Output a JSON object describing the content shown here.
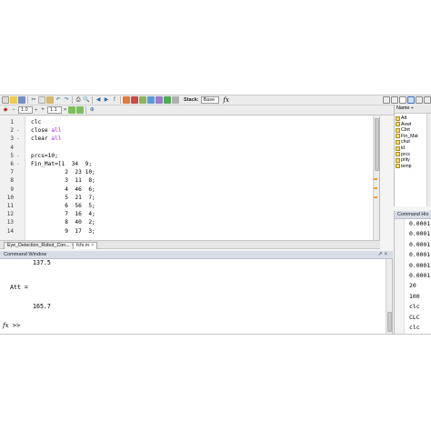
{
  "toolbar": {
    "stack_label": "Stack:",
    "stack_value": "Base",
    "fx_label": "fx",
    "cell_value_1": "1.0",
    "cell_divider": "÷",
    "cell_value_2": "1.1",
    "cell_times": "×"
  },
  "editor": {
    "lines": [
      {
        "n": "1",
        "fold": "",
        "segments": [
          {
            "t": "clc",
            "kw": false
          }
        ]
      },
      {
        "n": "2",
        "fold": "-",
        "segments": [
          {
            "t": "close ",
            "kw": false
          },
          {
            "t": "all",
            "kw": true
          }
        ]
      },
      {
        "n": "3",
        "fold": "-",
        "segments": [
          {
            "t": "clear ",
            "kw": false
          },
          {
            "t": "all",
            "kw": true
          }
        ]
      },
      {
        "n": "4",
        "fold": "",
        "segments": [
          {
            "t": "",
            "kw": false
          }
        ]
      },
      {
        "n": "5",
        "fold": "-",
        "segments": [
          {
            "t": "prcs=10;",
            "kw": false
          }
        ]
      },
      {
        "n": "6",
        "fold": "-",
        "segments": [
          {
            "t": "Fin_Mat=[1  34  9;",
            "kw": false
          }
        ]
      },
      {
        "n": "7",
        "fold": "",
        "segments": [
          {
            "t": "          2  23 10;",
            "kw": false
          }
        ]
      },
      {
        "n": "8",
        "fold": "",
        "segments": [
          {
            "t": "          3  11  8;",
            "kw": false
          }
        ]
      },
      {
        "n": "9",
        "fold": "",
        "segments": [
          {
            "t": "          4  46  6;",
            "kw": false
          }
        ]
      },
      {
        "n": "10",
        "fold": "",
        "segments": [
          {
            "t": "          5  21  7;",
            "kw": false
          }
        ]
      },
      {
        "n": "11",
        "fold": "",
        "segments": [
          {
            "t": "          6  56  5;",
            "kw": false
          }
        ]
      },
      {
        "n": "12",
        "fold": "",
        "segments": [
          {
            "t": "          7  16  4;",
            "kw": false
          }
        ]
      },
      {
        "n": "13",
        "fold": "",
        "segments": [
          {
            "t": "          8  40  2;",
            "kw": false
          }
        ]
      },
      {
        "n": "14",
        "fold": "",
        "segments": [
          {
            "t": "          9  17  3;",
            "kw": false
          }
        ]
      }
    ]
  },
  "tabs": [
    {
      "label": "Eye_Detection_Robot_Con...",
      "close": "×",
      "active": false
    },
    {
      "label": "fcfs.m",
      "close": "×",
      "active": true
    }
  ],
  "command_window": {
    "title": "Command Window",
    "output": [
      "137.5",
      "Att =",
      "165.7"
    ],
    "prompt_fx": "fx",
    "prompt": ">>"
  },
  "workspace": {
    "header": "Name ÷",
    "variables": [
      "Att",
      "Avwt",
      "Cbrt",
      "Fin_Mat",
      "chut",
      "id",
      "prcs",
      "prity",
      "temp"
    ]
  },
  "history": {
    "title": "Command His",
    "items": [
      "0.0001",
      "0.0001",
      "0.0001",
      "0.0001",
      "0.0001",
      "0.0001",
      "20",
      "100",
      "clc",
      "CLC",
      "clc"
    ]
  },
  "colors": {
    "keyword": "#a020f0",
    "panel_title": "#d8dde6",
    "window_bg": "#f4f4f4"
  }
}
